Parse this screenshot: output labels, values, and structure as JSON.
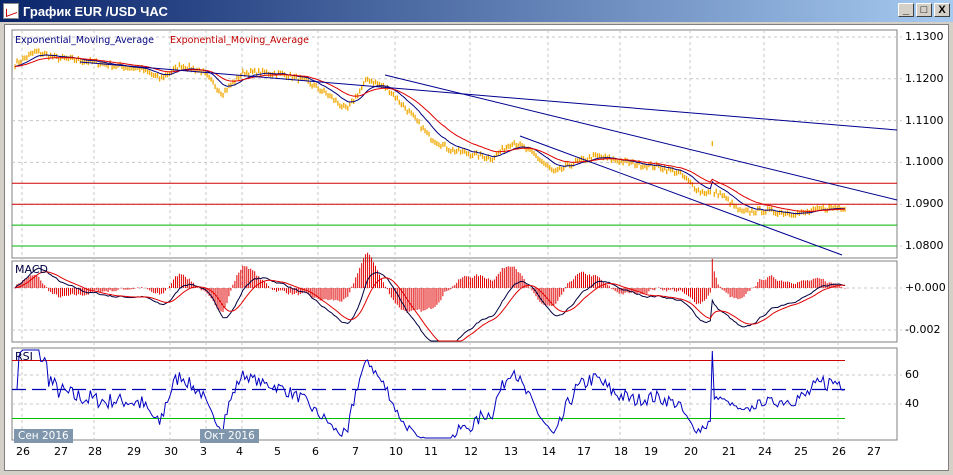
{
  "window": {
    "title": "График EUR /USD  ЧАС",
    "min": "_",
    "max": "□",
    "close": "X"
  },
  "legend": {
    "ema1": "Exponential_Moving_Average",
    "ema2": "Exponential_Moving_Average"
  },
  "panels": {
    "macd": "MACD",
    "rsi": "RSI"
  },
  "colors": {
    "price": "#f0a800",
    "ema_fast": "#000080",
    "ema_slow": "#e00000",
    "resistance": "#d00000",
    "support": "#00b000",
    "trend": "#000090"
  },
  "chart_data": [
    {
      "type": "line",
      "title": "EUR/USD H1",
      "ylim": [
        1.0775,
        1.1315
      ],
      "yticks": [
        "1.1300",
        "1.1200",
        "1.1100",
        "1.1000",
        "1.0900",
        "1.0800"
      ],
      "xticks": [
        "26",
        "27",
        "28",
        "29",
        "30",
        "3",
        "4",
        "5",
        "6",
        "7",
        "10",
        "11",
        "12",
        "13",
        "14",
        "17",
        "18",
        "19",
        "20",
        "21",
        "24",
        "25",
        "26",
        "27"
      ],
      "month_labels": [
        "Сен 2016",
        "Окт 2016"
      ],
      "price": [
        1.1235,
        1.1265,
        1.125,
        1.1245,
        1.1238,
        1.123,
        1.1225,
        1.12,
        1.1232,
        1.1218,
        1.1165,
        1.1215,
        1.1215,
        1.121,
        1.1195,
        1.1165,
        1.1125,
        1.12,
        1.1175,
        1.112,
        1.106,
        1.103,
        1.102,
        1.101,
        1.105,
        1.102,
        1.0975,
        1.1,
        1.1015,
        1.1005,
        1.0995,
        1.099,
        1.0975,
        1.093,
        1.0925,
        1.088,
        1.0885,
        1.088,
        1.0878,
        1.089,
        1.0893
      ],
      "horizontal_levels": {
        "red": [
          1.095,
          1.09
        ],
        "green": [
          1.085,
          1.08
        ]
      }
    },
    {
      "type": "line",
      "title": "MACD",
      "yticks": [
        "+0.000",
        "-0.002"
      ]
    },
    {
      "type": "line",
      "title": "RSI",
      "yticks": [
        "60",
        "40"
      ],
      "levels": [
        70,
        50,
        30
      ]
    }
  ]
}
